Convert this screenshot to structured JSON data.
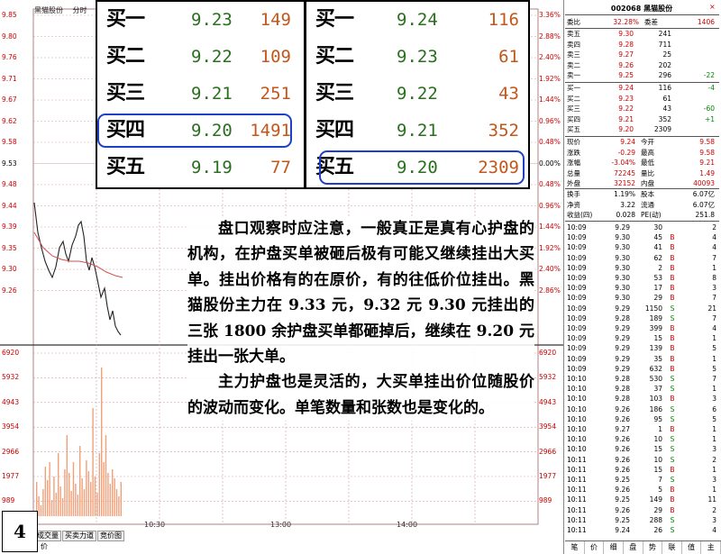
{
  "chart": {
    "header": [
      "黑猫股份",
      "分时",
      "均线"
    ],
    "price_axis_left": [
      "9.85",
      "9.80",
      "9.76",
      "9.71",
      "9.67",
      "9.62",
      "9.58",
      "9.53",
      "9.48",
      "9.44",
      "9.39",
      "9.35",
      "9.30",
      "9.26"
    ],
    "price_axis_right": [
      "3.36%",
      "2.88%",
      "2.40%",
      "1.92%",
      "1.44%",
      "0.96%",
      "0.48%",
      "0.00%",
      "0.48%",
      "0.96%",
      "1.44%",
      "1.92%",
      "2.40%",
      "2.86%"
    ],
    "volume_axis_left": [
      "6920",
      "5932",
      "4943",
      "3954",
      "2966",
      "1977",
      "989"
    ],
    "volume_axis_right": [
      "6920",
      "5932",
      "4943",
      "3954",
      "2966",
      "1977",
      "989"
    ],
    "time_axis": [
      "10:30",
      "13:00",
      "14:00"
    ],
    "bottom_tabs": [
      "成交量",
      "买卖力道",
      "竞价图"
    ],
    "bottom_left": "价",
    "page_number": "4",
    "colors": {
      "price_line": "#222222",
      "avg_line": "#d05050",
      "volume_bar": "#f2a07a",
      "grid": "#d0a0a0"
    }
  },
  "bids_left": [
    {
      "label": "买一",
      "price": "9.23",
      "volume": "149"
    },
    {
      "label": "买二",
      "price": "9.22",
      "volume": "109"
    },
    {
      "label": "买三",
      "price": "9.21",
      "volume": "251"
    },
    {
      "label": "买四",
      "price": "9.20",
      "volume": "1491"
    },
    {
      "label": "买五",
      "price": "9.19",
      "volume": "77"
    }
  ],
  "bids_right": [
    {
      "label": "买一",
      "price": "9.24",
      "volume": "116"
    },
    {
      "label": "买二",
      "price": "9.23",
      "volume": "61"
    },
    {
      "label": "买三",
      "price": "9.22",
      "volume": "43"
    },
    {
      "label": "买四",
      "price": "9.21",
      "volume": "352"
    },
    {
      "label": "买五",
      "price": "9.20",
      "volume": "2309"
    }
  ],
  "note": {
    "p1": "盘口观察时应注意，一般真正是真有心护盘的机构，在护盘买单被砸后极有可能又继续挂出大买单。挂出价格有的在原价，有的往低价位挂出。黑猫股份主力在 9.33 元，9.32 元 9.30 元挂出的三张 1800 余护盘买单都砸掉后，继续在 9.20 元挂出一张大单。",
    "p2": "主力护盘也是灵活的，大买单挂出价位随股价的波动而变化。单笔数量和张数也是变化的。"
  },
  "quote": {
    "title": "002068 黑猫股份",
    "close": "×",
    "weibi": {
      "label": "委比",
      "value": "32.28%",
      "label2": "委差",
      "value2": "1406"
    },
    "asks": [
      {
        "label": "卖五",
        "price": "9.30",
        "vol": "241",
        "chg": ""
      },
      {
        "label": "卖四",
        "price": "9.28",
        "vol": "711",
        "chg": ""
      },
      {
        "label": "卖三",
        "price": "9.27",
        "vol": "25",
        "chg": ""
      },
      {
        "label": "卖二",
        "price": "9.26",
        "vol": "202",
        "chg": ""
      },
      {
        "label": "卖一",
        "price": "9.25",
        "vol": "296",
        "chg": "-22"
      }
    ],
    "bids": [
      {
        "label": "买一",
        "price": "9.24",
        "vol": "116",
        "chg": "-4"
      },
      {
        "label": "买二",
        "price": "9.23",
        "vol": "61",
        "chg": ""
      },
      {
        "label": "买三",
        "price": "9.22",
        "vol": "43",
        "chg": "-60"
      },
      {
        "label": "买四",
        "price": "9.21",
        "vol": "352",
        "chg": "+1"
      },
      {
        "label": "买五",
        "price": "9.20",
        "vol": "2309",
        "chg": ""
      }
    ],
    "stats": [
      {
        "a": "现价",
        "b": "9.24",
        "c": "今开",
        "d": "9.58"
      },
      {
        "a": "涨跌",
        "b": "-0.29",
        "c": "最高",
        "d": "9.58"
      },
      {
        "a": "涨幅",
        "b": "-3.04%",
        "c": "最低",
        "d": "9.21"
      },
      {
        "a": "总量",
        "b": "72245",
        "c": "量比",
        "d": "1.49"
      },
      {
        "a": "外盘",
        "b": "32152",
        "c": "内盘",
        "d": "40093"
      }
    ],
    "stats2": [
      {
        "a": "换手",
        "b": "1.19%",
        "c": "股本",
        "d": "6.07亿"
      },
      {
        "a": "净资",
        "b": "3.22",
        "c": "流通",
        "d": "6.07亿"
      },
      {
        "a": "收益(四)",
        "b": "0.028",
        "c": "PE(动)",
        "d": "251.8"
      }
    ],
    "trades": [
      {
        "t": "10:09",
        "p": "9.29",
        "v": "30",
        "s": "",
        "n": "2"
      },
      {
        "t": "10:09",
        "p": "9.30",
        "v": "45",
        "s": "B",
        "n": "4"
      },
      {
        "t": "10:09",
        "p": "9.30",
        "v": "41",
        "s": "B",
        "n": "4"
      },
      {
        "t": "10:09",
        "p": "9.30",
        "v": "62",
        "s": "B",
        "n": "7"
      },
      {
        "t": "10:09",
        "p": "9.30",
        "v": "2",
        "s": "B",
        "n": "1"
      },
      {
        "t": "10:09",
        "p": "9.30",
        "v": "53",
        "s": "B",
        "n": "8"
      },
      {
        "t": "10:09",
        "p": "9.30",
        "v": "17",
        "s": "B",
        "n": "3"
      },
      {
        "t": "10:09",
        "p": "9.30",
        "v": "29",
        "s": "B",
        "n": "7"
      },
      {
        "t": "10:09",
        "p": "9.29",
        "v": "1150",
        "s": "S",
        "n": "21"
      },
      {
        "t": "10:09",
        "p": "9.28",
        "v": "189",
        "s": "S",
        "n": "7"
      },
      {
        "t": "10:09",
        "p": "9.29",
        "v": "399",
        "s": "B",
        "n": "4"
      },
      {
        "t": "10:09",
        "p": "9.29",
        "v": "15",
        "s": "B",
        "n": "1"
      },
      {
        "t": "10:09",
        "p": "9.29",
        "v": "139",
        "s": "B",
        "n": "5"
      },
      {
        "t": "10:09",
        "p": "9.29",
        "v": "35",
        "s": "B",
        "n": "1"
      },
      {
        "t": "10:09",
        "p": "9.29",
        "v": "632",
        "s": "B",
        "n": "5"
      },
      {
        "t": "10:10",
        "p": "9.28",
        "v": "530",
        "s": "S",
        "n": "7"
      },
      {
        "t": "10:10",
        "p": "9.28",
        "v": "37",
        "s": "S",
        "n": "1"
      },
      {
        "t": "10:10",
        "p": "9.28",
        "v": "103",
        "s": "B",
        "n": "3"
      },
      {
        "t": "10:10",
        "p": "9.26",
        "v": "186",
        "s": "S",
        "n": "6"
      },
      {
        "t": "10:10",
        "p": "9.26",
        "v": "95",
        "s": "S",
        "n": "5"
      },
      {
        "t": "10:10",
        "p": "9.27",
        "v": "1",
        "s": "B",
        "n": "1"
      },
      {
        "t": "10:10",
        "p": "9.26",
        "v": "10",
        "s": "S",
        "n": "1"
      },
      {
        "t": "10:10",
        "p": "9.26",
        "v": "15",
        "s": "S",
        "n": "3"
      },
      {
        "t": "10:11",
        "p": "9.26",
        "v": "10",
        "s": "S",
        "n": "2"
      },
      {
        "t": "10:11",
        "p": "9.26",
        "v": "15",
        "s": "B",
        "n": "1"
      },
      {
        "t": "10:11",
        "p": "9.25",
        "v": "7",
        "s": "S",
        "n": "3"
      },
      {
        "t": "10:11",
        "p": "9.26",
        "v": "5",
        "s": "B",
        "n": "1"
      },
      {
        "t": "10:11",
        "p": "9.25",
        "v": "149",
        "s": "B",
        "n": "11"
      },
      {
        "t": "10:11",
        "p": "9.26",
        "v": "29",
        "s": "B",
        "n": "2"
      },
      {
        "t": "10:11",
        "p": "9.25",
        "v": "288",
        "s": "S",
        "n": "3"
      },
      {
        "t": "10:11",
        "p": "9.24",
        "v": "26",
        "s": "S",
        "n": "4"
      }
    ],
    "tabs": [
      "笔",
      "价",
      "细",
      "盘",
      "势",
      "联",
      "值",
      "主"
    ]
  }
}
